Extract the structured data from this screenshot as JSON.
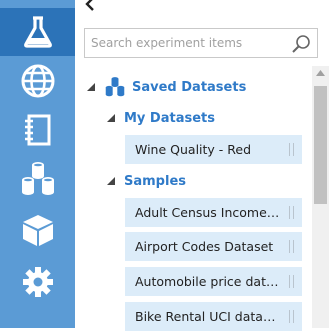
{
  "search": {
    "placeholder": "Search experiment items"
  },
  "nav": {
    "items": [
      {
        "id": "experiments",
        "icon": "flask-icon",
        "active": true
      },
      {
        "id": "web-services",
        "icon": "globe-icon",
        "active": false
      },
      {
        "id": "notebooks",
        "icon": "notebook-icon",
        "active": false
      },
      {
        "id": "datasets",
        "icon": "datasets-icon",
        "active": false
      },
      {
        "id": "trained-models",
        "icon": "cube-icon",
        "active": false
      },
      {
        "id": "settings",
        "icon": "gear-icon",
        "active": false
      }
    ]
  },
  "tree": {
    "saved_datasets": {
      "label": "Saved Datasets"
    },
    "my_datasets": {
      "label": "My Datasets",
      "items": [
        "Wine Quality - Red"
      ]
    },
    "samples": {
      "label": "Samples",
      "items": [
        "Adult Census Income Binary Classification dataset",
        "Airport Codes Dataset",
        "Automobile price data (Raw)",
        "Bike Rental UCI dataset"
      ]
    }
  },
  "colors": {
    "rail": "#5b9bd5",
    "rail_active": "#2c73b8",
    "accent": "#2f7ac8",
    "item_bg": "#dcecf9"
  }
}
